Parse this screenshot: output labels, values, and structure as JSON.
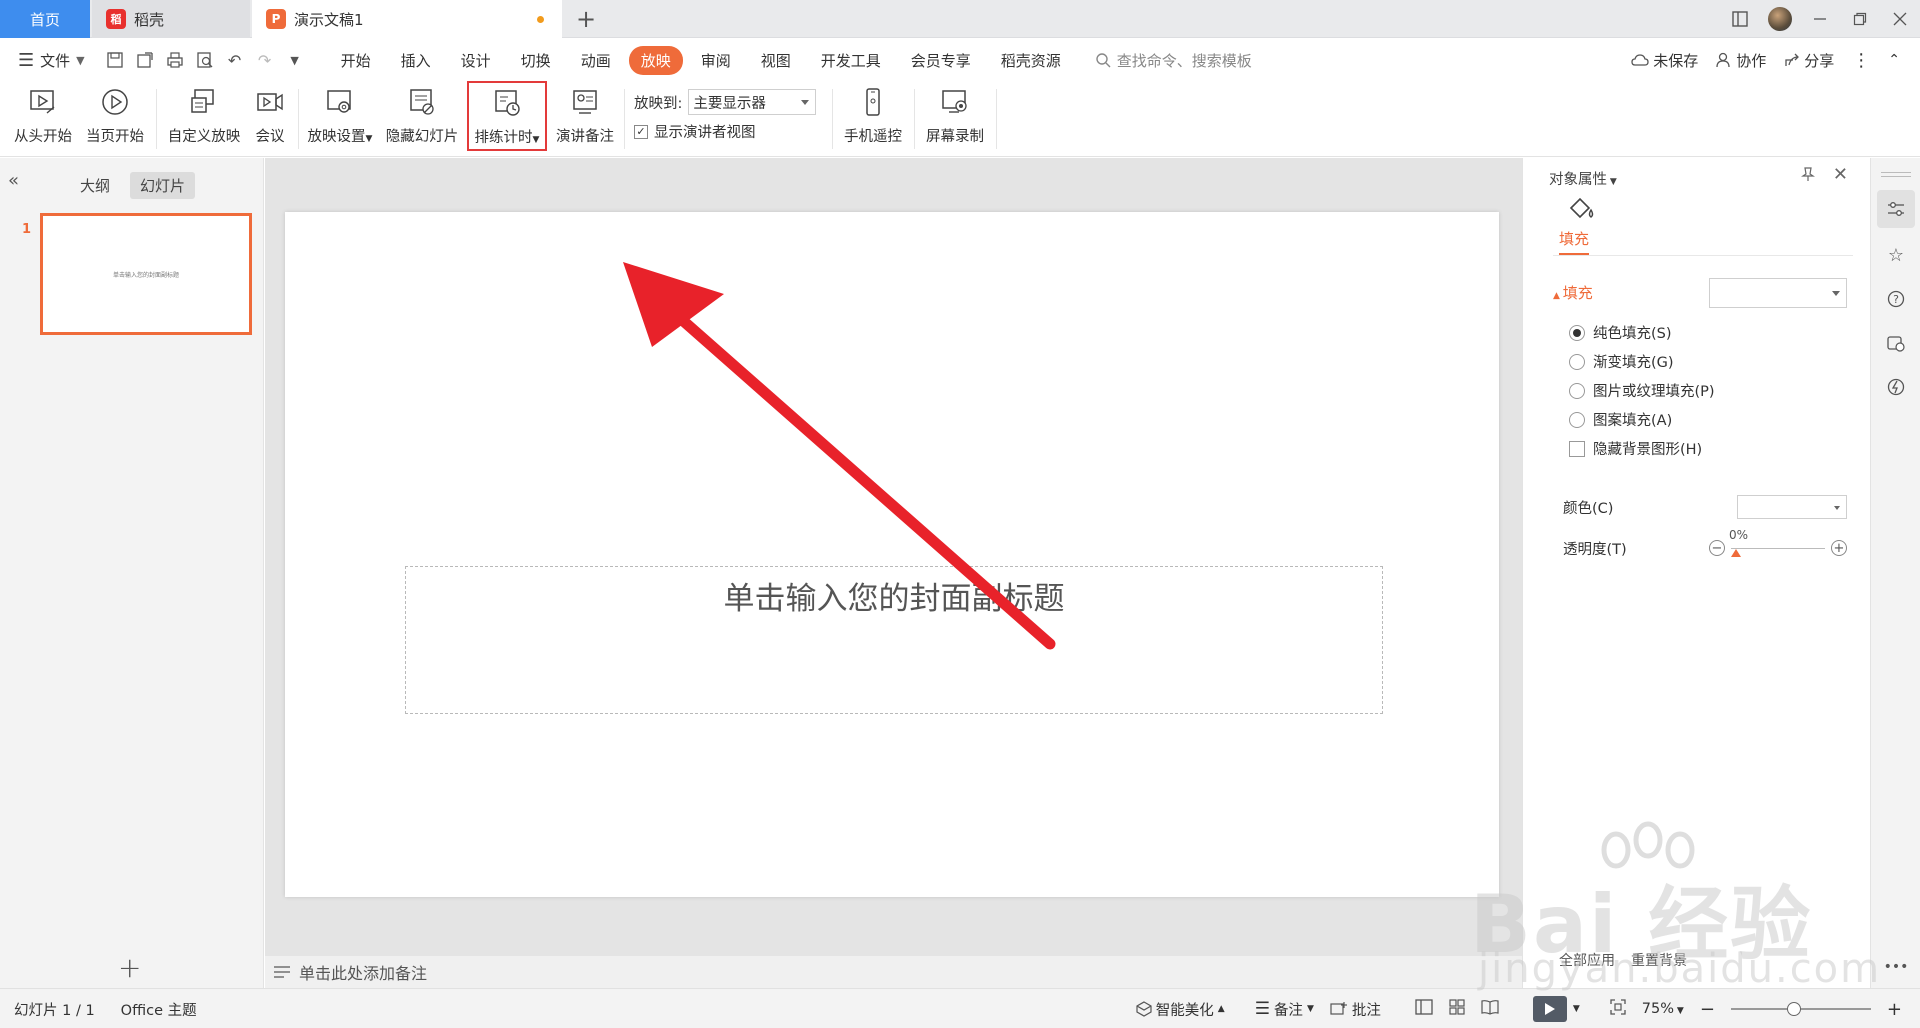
{
  "tabs": {
    "home": "首页",
    "daoke": "稻壳",
    "doc": "演示文稿1",
    "new_tab": "+"
  },
  "menu": {
    "file": "文件",
    "tabs": [
      "开始",
      "插入",
      "设计",
      "切换",
      "动画",
      "放映",
      "审阅",
      "视图",
      "开发工具",
      "会员专享",
      "稻壳资源"
    ],
    "active_tab": "放映",
    "search_placeholder": "查找命令、搜索模板",
    "unsaved": "未保存",
    "collab": "协作",
    "share": "分享"
  },
  "ribbon": {
    "from_start": "从头开始",
    "from_current": "当页开始",
    "custom_show": "自定义放映",
    "meeting": "会议",
    "show_settings": "放映设置",
    "hide_slide": "隐藏幻灯片",
    "rehearse_timing": "排练计时",
    "speaker_notes": "演讲备注",
    "show_to_label": "放映到:",
    "show_to_value": "主要显示器",
    "presenter_view": "显示演讲者视图",
    "phone_remote": "手机遥控",
    "screen_record": "屏幕录制"
  },
  "left_panel": {
    "tab_outline": "大纲",
    "tab_slides": "幻灯片",
    "slide_number": "1",
    "thumb_text": "单击输入您的封面副标题",
    "add": "+"
  },
  "slide": {
    "subtitle_placeholder": "单击输入您的封面副标题"
  },
  "notes": {
    "placeholder": "单击此处添加备注"
  },
  "properties": {
    "header": "对象属性",
    "fill_tab": "填充",
    "section": "填充",
    "options": [
      "纯色填充(S)",
      "渐变填充(G)",
      "图片或纹理填充(P)",
      "图案填充(A)"
    ],
    "hide_bg": "隐藏背景图形(H)",
    "color_label": "颜色(C)",
    "transparency_label": "透明度(T)",
    "transparency_value": "0%",
    "apply_all": "全部应用",
    "reset_bg": "重置背景"
  },
  "status": {
    "slide_info": "幻灯片 1 / 1",
    "theme": "Office 主题",
    "beautify": "智能美化",
    "notes": "备注",
    "comments": "批注",
    "zoom": "75%"
  },
  "watermark": {
    "big": "Bai 经验",
    "small": "jingyan.baidu.com"
  },
  "colors": {
    "accent": "#ef6b3a",
    "home_tab": "#3e8dee",
    "arrow": "#e8222a",
    "highlight_border": "#e33a3a"
  }
}
